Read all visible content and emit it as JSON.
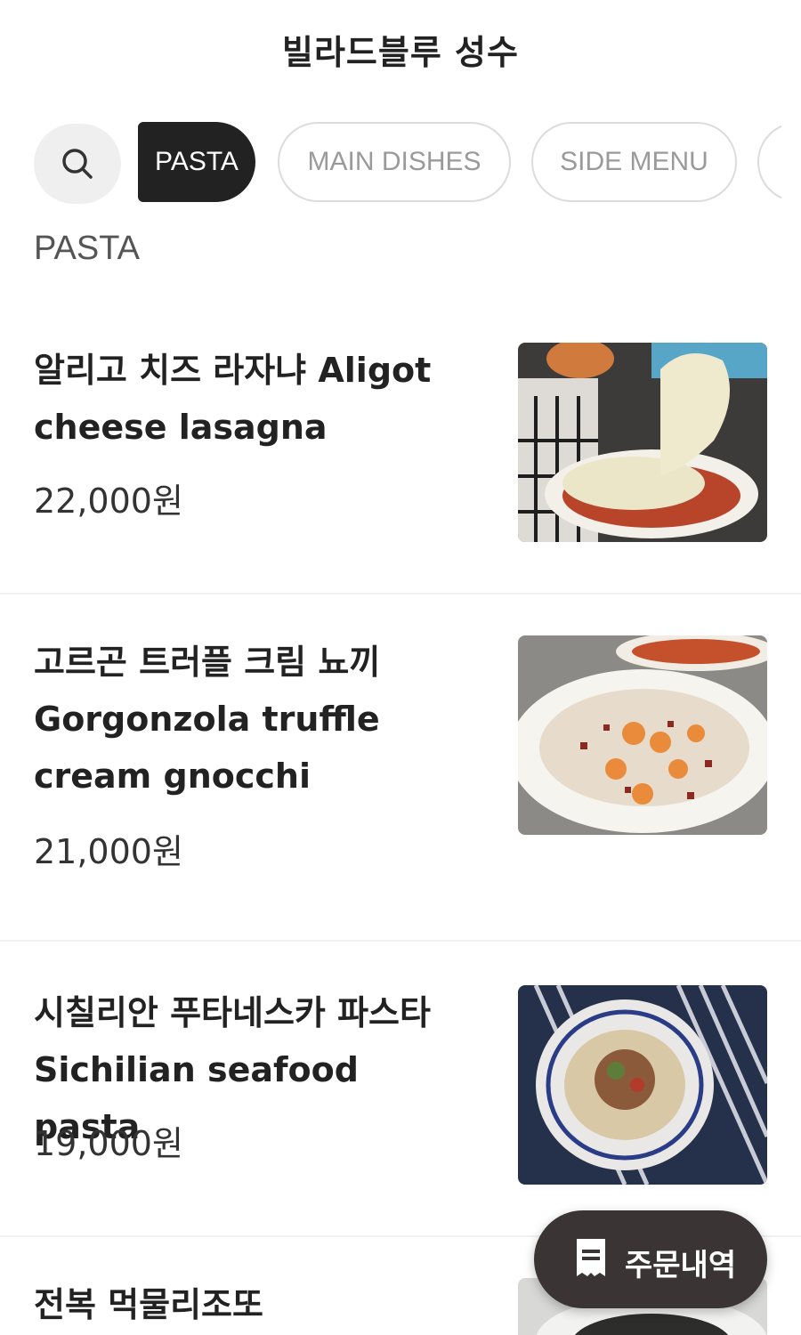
{
  "header": {
    "title": "빌라드블루 성수"
  },
  "tabs": {
    "search_icon": "search-icon",
    "items": [
      {
        "label": "PASTA",
        "active": true
      },
      {
        "label": "MAIN DISHES",
        "active": false
      },
      {
        "label": "SIDE MENU",
        "active": false
      }
    ]
  },
  "section": {
    "title": "PASTA"
  },
  "menu": [
    {
      "name": "알리고 치즈 라자냐 Aligot cheese lasagna",
      "price": "22,000원",
      "photo": "lasagna-photo"
    },
    {
      "name": "고르곤 트러플 크림 뇨끼 Gorgonzola truffle cream gnocchi",
      "price": "21,000원",
      "photo": "gnocchi-photo"
    },
    {
      "name": "시칠리안 푸타네스카 파스타 Sichilian seafood pasta",
      "price": "19,000원",
      "photo": "seafood-pasta-photo"
    },
    {
      "name": "전복 먹물리조또",
      "price": "",
      "photo": "risotto-photo"
    }
  ],
  "order_button": {
    "label": "주문내역",
    "icon": "receipt-icon"
  },
  "colors": {
    "dark": "#222222",
    "muted": "#9a9a9a",
    "order_bg": "#3a3434"
  }
}
